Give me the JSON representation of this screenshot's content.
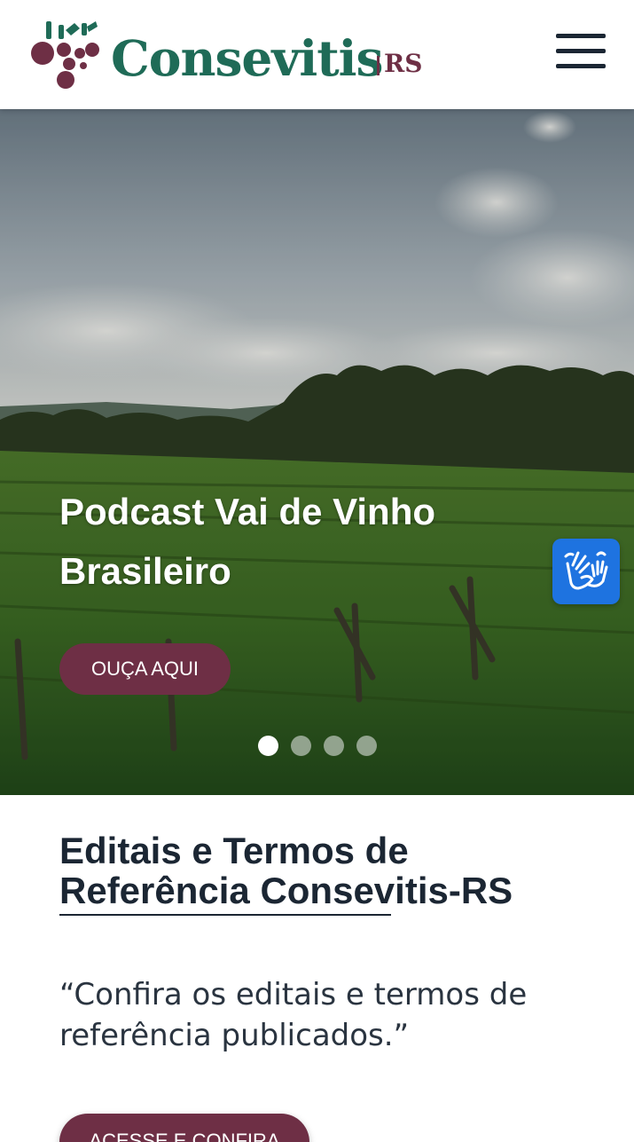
{
  "header": {
    "logo_text": "Consevitis",
    "logo_suffix": "RS",
    "menu_icon": "hamburger-menu-icon"
  },
  "hero": {
    "title_line1": "Podcast Vai de Vinho",
    "title_line2": "Brasileiro",
    "button_label": "OUÇA AQUI",
    "slides_count": 4,
    "active_slide": 1
  },
  "accessibility": {
    "icon": "sign-language-hands-icon"
  },
  "section": {
    "title": "Editais e Termos de Referência Consevitis-RS",
    "quote": "“Confira os editais e termos de referência publicados.”",
    "button_label": "ACESSE E CONFIRA"
  },
  "colors": {
    "brand_green": "#1f6b57",
    "brand_wine": "#6e2f45",
    "text_dark": "#1b2633",
    "libras_blue": "#1e73e0"
  }
}
